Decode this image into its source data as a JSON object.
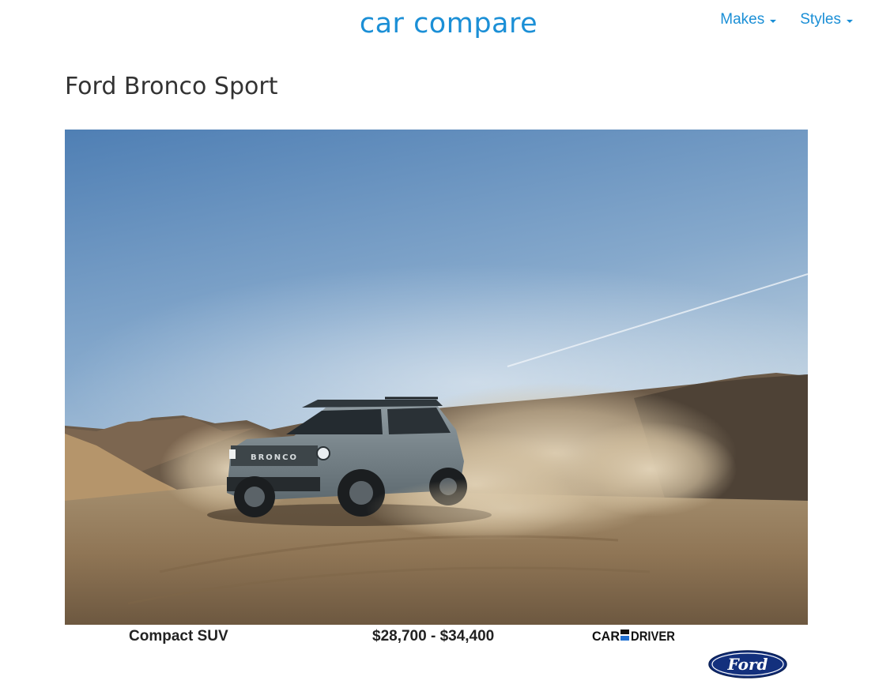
{
  "header": {
    "site_name": "car compare",
    "nav": [
      {
        "label": "Makes"
      },
      {
        "label": "Styles"
      }
    ]
  },
  "page": {
    "title": "Ford Bronco Sport"
  },
  "hero": {
    "description": "Ford Bronco Sport driving on dirt trail kicking up dust"
  },
  "specs": {
    "style": "Compact SUV",
    "price_range": "$28,700 - $34,400"
  },
  "source": {
    "logo_text": "CAR AND DRIVER"
  },
  "brand": {
    "logo_text": "Ford"
  },
  "colors": {
    "accent": "#1b8fd6",
    "title": "#333333",
    "ford_blue": "#13307d"
  }
}
